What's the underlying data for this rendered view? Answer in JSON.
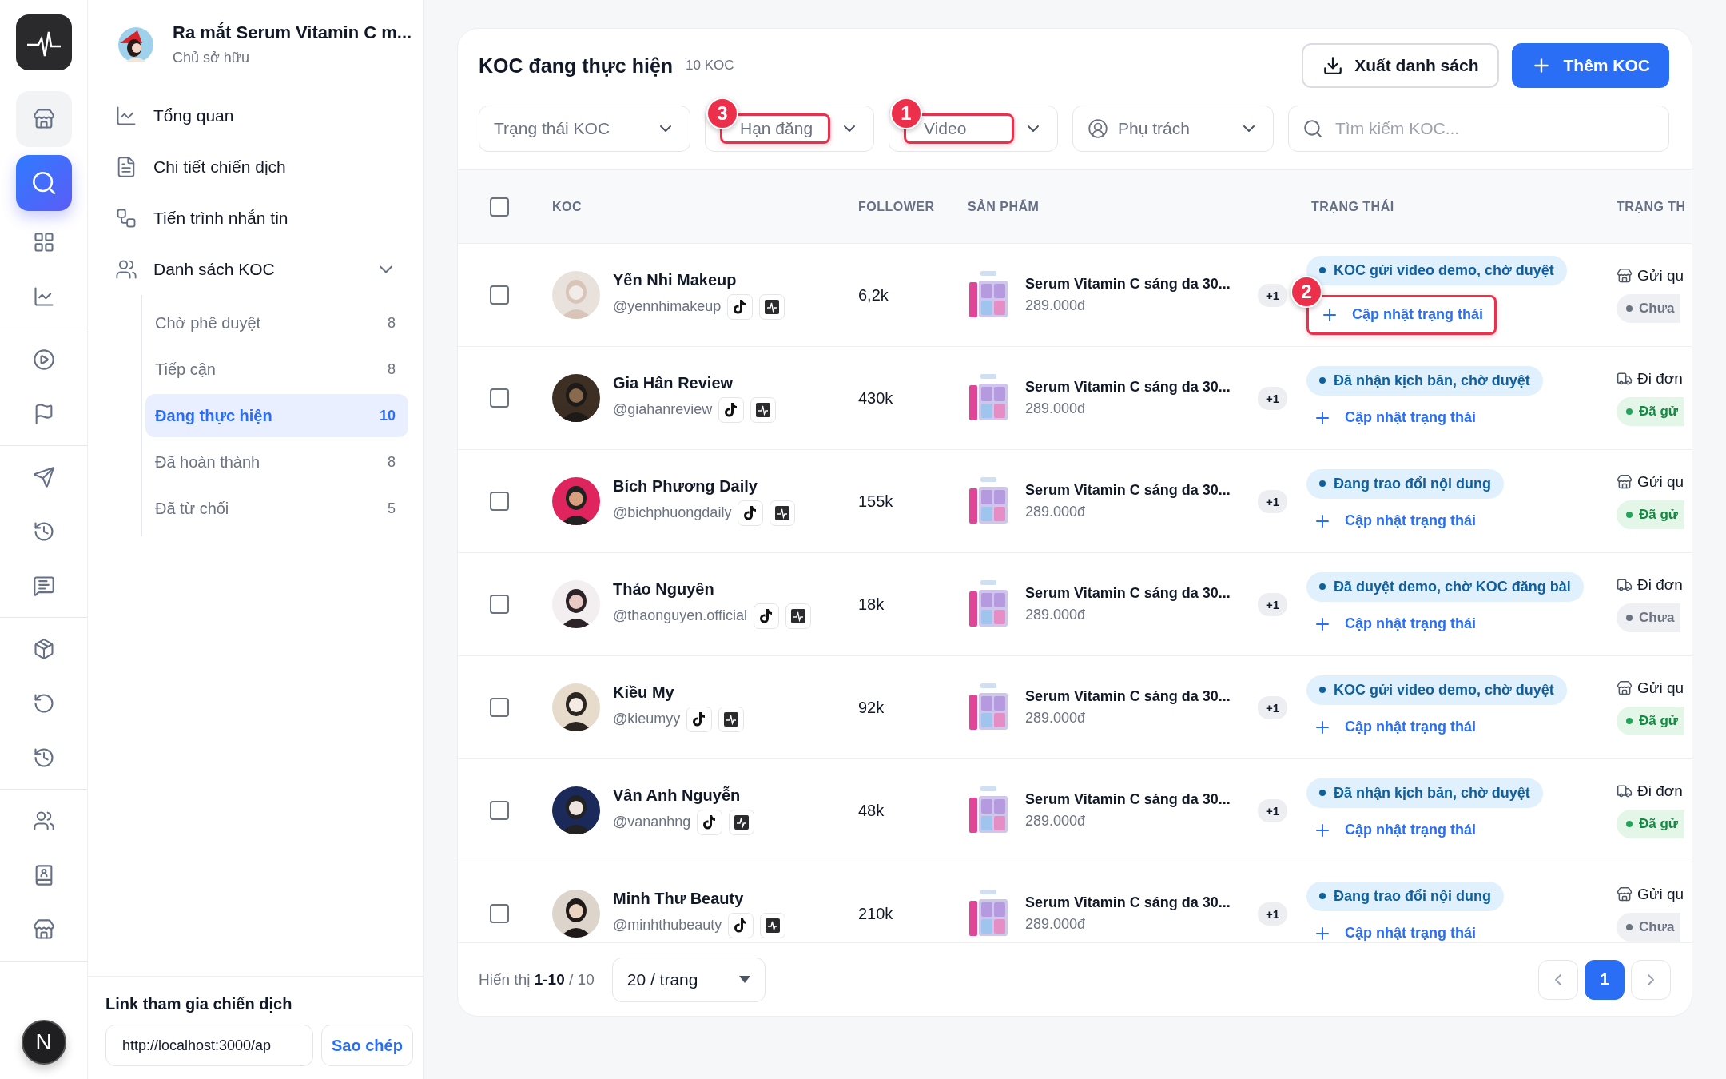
{
  "rail": {
    "user": {
      "initial": "N"
    },
    "groups": [
      [
        {
          "selected": false,
          "hovered": true
        },
        {
          "selected": true,
          "hovered": false
        },
        {
          "selected": false,
          "hovered": false
        },
        {
          "selected": false,
          "hovered": false
        }
      ],
      [
        {
          "selected": false,
          "hovered": false
        },
        {
          "selected": false,
          "hovered": false
        }
      ],
      [
        {
          "selected": false,
          "hovered": false
        },
        {
          "selected": false,
          "hovered": false
        },
        {
          "selected": false,
          "hovered": false
        }
      ],
      [
        {
          "selected": false,
          "hovered": false
        },
        {
          "selected": false,
          "hovered": false
        },
        {
          "selected": false,
          "hovered": false
        }
      ],
      [
        {
          "selected": false,
          "hovered": false
        },
        {
          "selected": false,
          "hovered": false
        },
        {
          "selected": false,
          "hovered": false
        }
      ]
    ]
  },
  "sidebar": {
    "campaign": {
      "title": "Ra mắt Serum Vitamin C m...",
      "role": "Chủ sở hữu"
    },
    "nav": [
      {
        "label": "Tổng quan",
        "selected": false
      },
      {
        "label": "Chi tiết chiến dịch",
        "selected": false
      },
      {
        "label": "Tiến trình nhắn tin",
        "selected": false
      },
      {
        "label": "Danh sách KOC",
        "selected": false,
        "expanded": true,
        "children": [
          {
            "label": "Chờ phê duyệt",
            "count": "8",
            "selected": false
          },
          {
            "label": "Tiếp cận",
            "count": "8",
            "selected": false
          },
          {
            "label": "Đang thực hiện",
            "count": "10",
            "selected": true
          },
          {
            "label": "Đã hoàn thành",
            "count": "8",
            "selected": false
          },
          {
            "label": "Đã từ chối",
            "count": "5",
            "selected": false
          }
        ]
      }
    ],
    "join_link": {
      "title": "Link tham gia chiến dịch",
      "value": "http://localhost:3000/ap",
      "button": "Sao chép"
    }
  },
  "header": {
    "title": "KOC đang thực hiện",
    "count": "10 KOC",
    "actions": [
      {
        "label": "Xuất danh sách",
        "kind": "secondary"
      },
      {
        "label": "Thêm KOC",
        "kind": "primary"
      }
    ]
  },
  "filters": [
    {
      "kind": "select",
      "label": "Trạng thái KOC"
    },
    {
      "kind": "select",
      "label": "Hạn đăng",
      "annotation": "3"
    },
    {
      "kind": "select",
      "label": "Video",
      "annotation": "1"
    },
    {
      "kind": "person",
      "label": "Phụ trách"
    },
    {
      "kind": "search",
      "placeholder": "Tìm kiếm KOC..."
    }
  ],
  "table": {
    "select_all": {
      "checked": false
    },
    "columns": [
      "KOC",
      "FOLLOWER",
      "SẢN PHẨM",
      "TRẠNG THÁI",
      "TRẠNG TH"
    ],
    "rows": [
      {
        "checked": false,
        "name": "Yến Nhi Makeup",
        "handle": "@yennhimakeup",
        "follower": "6,2k",
        "product": {
          "name": "Serum Vitamin C sáng da 30...",
          "price": "289.000đ",
          "extra": "+1"
        },
        "status": "KOC gửi video demo, chờ duyệt",
        "action": "Cập nhật trạng thái",
        "annotation": "2",
        "delivery": {
          "kind": "store",
          "label": "Gửi qu"
        },
        "shipping": {
          "label": "Chưa",
          "color": "#6b7280"
        }
      },
      {
        "checked": false,
        "name": "Gia Hân Review",
        "handle": "@giahanreview",
        "follower": "430k",
        "product": {
          "name": "Serum Vitamin C sáng da 30...",
          "price": "289.000đ",
          "extra": "+1"
        },
        "status": "Đã nhận kịch bản, chờ duyệt",
        "action": "Cập nhật trạng thái",
        "delivery": {
          "kind": "truck",
          "label": "Đi đơn"
        },
        "shipping": {
          "label": "Đã gử",
          "color": "#22a55a"
        }
      },
      {
        "checked": false,
        "name": "Bích Phương Daily",
        "handle": "@bichphuongdaily",
        "follower": "155k",
        "product": {
          "name": "Serum Vitamin C sáng da 30...",
          "price": "289.000đ",
          "extra": "+1"
        },
        "status": "Đang trao đổi nội dung",
        "action": "Cập nhật trạng thái",
        "delivery": {
          "kind": "store",
          "label": "Gửi qu"
        },
        "shipping": {
          "label": "Đã gử",
          "color": "#22a55a"
        }
      },
      {
        "checked": false,
        "name": "Thảo Nguyên",
        "handle": "@thaonguyen.official",
        "follower": "18k",
        "product": {
          "name": "Serum Vitamin C sáng da 30...",
          "price": "289.000đ",
          "extra": "+1"
        },
        "status": "Đã duyệt demo, chờ KOC đăng bài",
        "action": "Cập nhật trạng thái",
        "delivery": {
          "kind": "truck",
          "label": "Đi đơn"
        },
        "shipping": {
          "label": "Chưa",
          "color": "#6b7280"
        }
      },
      {
        "checked": false,
        "name": "Kiều My",
        "handle": "@kieumyy",
        "follower": "92k",
        "product": {
          "name": "Serum Vitamin C sáng da 30...",
          "price": "289.000đ",
          "extra": "+1"
        },
        "status": "KOC gửi video demo, chờ duyệt",
        "action": "Cập nhật trạng thái",
        "delivery": {
          "kind": "store",
          "label": "Gửi qu"
        },
        "shipping": {
          "label": "Đã gử",
          "color": "#22a55a"
        }
      },
      {
        "checked": false,
        "name": "Vân Anh Nguyễn",
        "handle": "@vananhng",
        "follower": "48k",
        "product": {
          "name": "Serum Vitamin C sáng da 30...",
          "price": "289.000đ",
          "extra": "+1"
        },
        "status": "Đã nhận kịch bản, chờ duyệt",
        "action": "Cập nhật trạng thái",
        "delivery": {
          "kind": "truck",
          "label": "Đi đơn"
        },
        "shipping": {
          "label": "Đã gử",
          "color": "#22a55a"
        }
      },
      {
        "checked": false,
        "name": "Minh Thư Beauty",
        "handle": "@minhthubeauty",
        "follower": "210k",
        "product": {
          "name": "Serum Vitamin C sáng da 30...",
          "price": "289.000đ",
          "extra": "+1"
        },
        "status": "Đang trao đổi nội dung",
        "action": "Cập nhật trạng thái",
        "delivery": {
          "kind": "store",
          "label": "Gửi qu"
        },
        "shipping": {
          "label": "Chưa",
          "color": "#6b7280"
        }
      }
    ]
  },
  "footer": {
    "summary": "Hiển thị **1-10** / 10",
    "page_size": "20 / trang",
    "pages": [
      {
        "label": "1",
        "selected": true
      }
    ]
  }
}
